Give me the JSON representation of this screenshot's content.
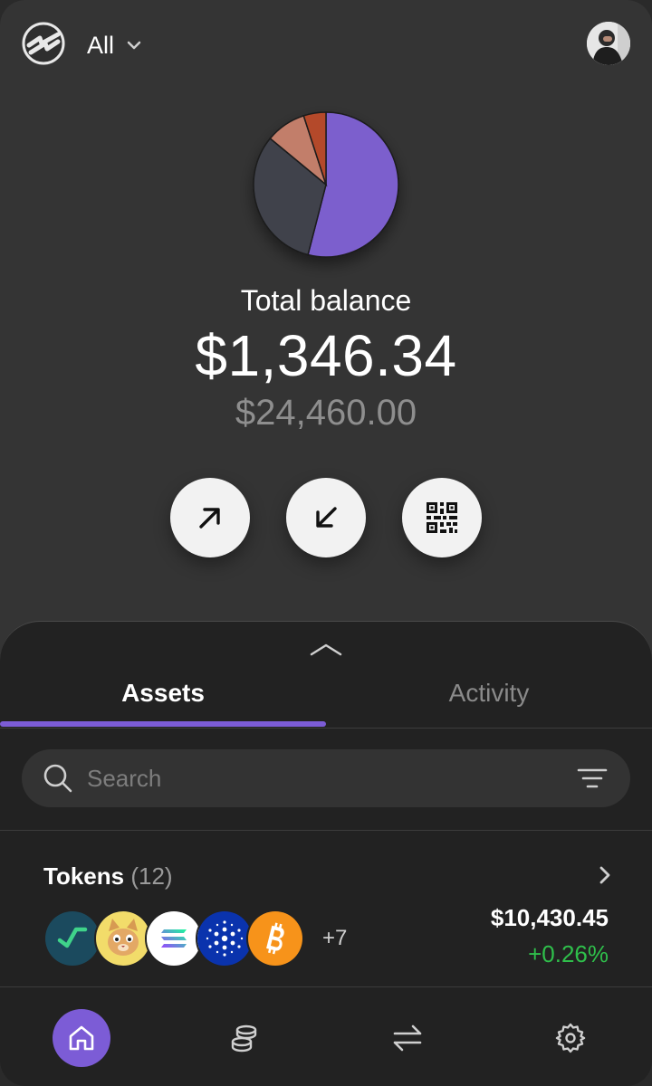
{
  "header": {
    "account_selector": "All",
    "logo_icon": "brand-logo-icon",
    "avatar_icon": "user-avatar"
  },
  "portfolio_chart": {
    "chart_data": {
      "type": "pie",
      "values": [
        54,
        32,
        9,
        5
      ],
      "colors": [
        "#7b5fcd",
        "#3f424c",
        "#c27e6a",
        "#b44a2a"
      ]
    }
  },
  "balance": {
    "label": "Total balance",
    "amount": "$1,346.34",
    "secondary": "$24,460.00"
  },
  "actions": [
    {
      "name": "send-button",
      "icon": "arrow-up-right-icon"
    },
    {
      "name": "receive-button",
      "icon": "arrow-down-left-icon"
    },
    {
      "name": "qr-code-button",
      "icon": "qr-code-icon"
    }
  ],
  "sheet": {
    "tabs": [
      {
        "label": "Assets",
        "active": true
      },
      {
        "label": "Activity",
        "active": false
      }
    ],
    "search": {
      "placeholder": "Search"
    },
    "tokens": {
      "title": "Tokens",
      "count": "(12)",
      "more": "+7",
      "value": "$10,430.45",
      "change": "+0.26%",
      "icons": [
        "chart-token-icon",
        "cat-token-icon",
        "solana-icon",
        "cardano-icon",
        "bitcoin-icon"
      ]
    }
  },
  "nav": [
    {
      "name": "home",
      "icon": "home-icon",
      "active": true
    },
    {
      "name": "assets",
      "icon": "coins-icon",
      "active": false
    },
    {
      "name": "swap",
      "icon": "swap-icon",
      "active": false
    },
    {
      "name": "settings",
      "icon": "gear-icon",
      "active": false
    }
  ],
  "colors": {
    "accent": "#7c5cd6",
    "positive": "#2fbf4b",
    "background": "#343434",
    "sheet": "#222222"
  }
}
